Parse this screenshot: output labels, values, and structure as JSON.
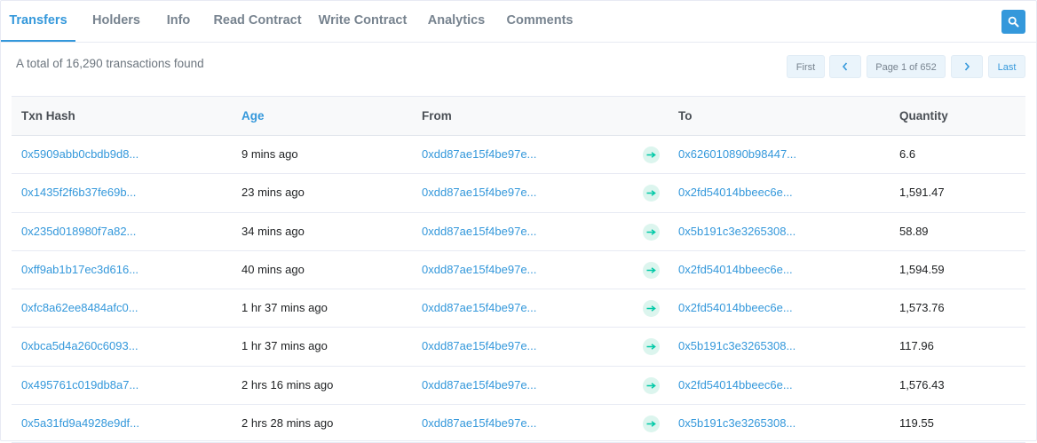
{
  "tabs": [
    {
      "label": "Transfers",
      "active": true
    },
    {
      "label": "Holders"
    },
    {
      "label": "Info"
    },
    {
      "label": "Read Contract"
    },
    {
      "label": "Write Contract"
    },
    {
      "label": "Analytics"
    },
    {
      "label": "Comments"
    }
  ],
  "search_icon": "search-icon",
  "summary": "A total of 16,290 transactions found",
  "pager": {
    "first": "First",
    "prev_icon": "chevron-left-icon",
    "page": "Page 1 of 652",
    "next_icon": "chevron-right-icon",
    "last": "Last"
  },
  "columns": {
    "hash": "Txn Hash",
    "age": "Age",
    "from": "From",
    "to": "To",
    "qty": "Quantity"
  },
  "rows": [
    {
      "hash": "0x5909abb0cbdb9d8...",
      "age": "9 mins ago",
      "from": "0xdd87ae15f4be97e...",
      "to": "0x626010890b98447...",
      "qty": "6.6"
    },
    {
      "hash": "0x1435f2f6b37fe69b...",
      "age": "23 mins ago",
      "from": "0xdd87ae15f4be97e...",
      "to": "0x2fd54014bbeec6e...",
      "qty": "1,591.47"
    },
    {
      "hash": "0x235d018980f7a82...",
      "age": "34 mins ago",
      "from": "0xdd87ae15f4be97e...",
      "to": "0x5b191c3e3265308...",
      "qty": "58.89"
    },
    {
      "hash": "0xff9ab1b17ec3d616...",
      "age": "40 mins ago",
      "from": "0xdd87ae15f4be97e...",
      "to": "0x2fd54014bbeec6e...",
      "qty": "1,594.59"
    },
    {
      "hash": "0xfc8a62ee8484afc0...",
      "age": "1 hr 37 mins ago",
      "from": "0xdd87ae15f4be97e...",
      "to": "0x2fd54014bbeec6e...",
      "qty": "1,573.76"
    },
    {
      "hash": "0xbca5d4a260c6093...",
      "age": "1 hr 37 mins ago",
      "from": "0xdd87ae15f4be97e...",
      "to": "0x5b191c3e3265308...",
      "qty": "117.96"
    },
    {
      "hash": "0x495761c019db8a7...",
      "age": "2 hrs 16 mins ago",
      "from": "0xdd87ae15f4be97e...",
      "to": "0x2fd54014bbeec6e...",
      "qty": "1,576.43"
    },
    {
      "hash": "0x5a31fd9a4928e9df...",
      "age": "2 hrs 28 mins ago",
      "from": "0xdd87ae15f4be97e...",
      "to": "0x5b191c3e3265308...",
      "qty": "119.55"
    }
  ],
  "transfer_icon": "arrow-right-icon",
  "colors": {
    "accent": "#3498db",
    "success": "#00c9a7",
    "muted": "#77838f"
  }
}
